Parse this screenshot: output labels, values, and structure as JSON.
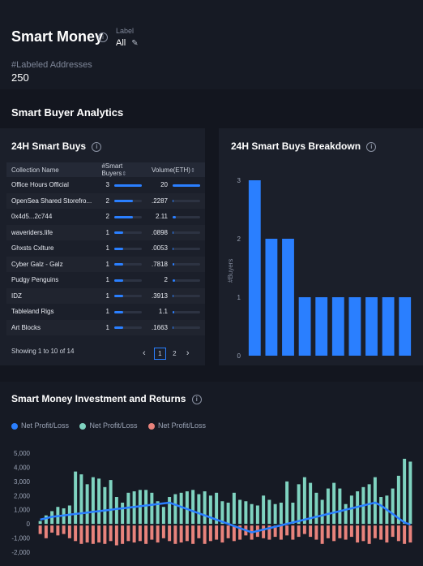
{
  "header": {
    "title": "Smart Money",
    "label_caption": "Label",
    "label_value": "All",
    "count_caption": "#Labeled Addresses",
    "count_value": "250"
  },
  "section_title": "Smart Buyer Analytics",
  "smart_buys": {
    "title": "24H Smart Buys",
    "columns": [
      "Collection Name",
      "#Smart Buyers",
      "Volume(ETH)"
    ],
    "rows": [
      {
        "name": "Office Hours Official",
        "buyers": "3",
        "volume": "20"
      },
      {
        "name": "OpenSea Shared Storefro...",
        "buyers": "2",
        "volume": ".2287"
      },
      {
        "name": "0x4d5...2c744",
        "buyers": "2",
        "volume": "2.11"
      },
      {
        "name": "waveriders.life",
        "buyers": "1",
        "volume": ".0898"
      },
      {
        "name": "Ghxsts Cxlture",
        "buyers": "1",
        "volume": ".0053"
      },
      {
        "name": "Cyber Galz - Galz",
        "buyers": "1",
        "volume": ".7818"
      },
      {
        "name": "Pudgy Penguins",
        "buyers": "1",
        "volume": "2"
      },
      {
        "name": "IDZ",
        "buyers": "1",
        "volume": ".3913"
      },
      {
        "name": "Tableland Rigs",
        "buyers": "1",
        "volume": "1.1"
      },
      {
        "name": "Art Blocks",
        "buyers": "1",
        "volume": ".1663"
      }
    ],
    "buyers_fraction": [
      1,
      0.67,
      0.67,
      0.33,
      0.33,
      0.33,
      0.33,
      0.33,
      0.33,
      0.33
    ],
    "volume_fraction": [
      1,
      0.03,
      0.11,
      0.02,
      0.01,
      0.05,
      0.1,
      0.03,
      0.06,
      0.02
    ],
    "footer": "Showing 1 to 10 of 14",
    "pages": [
      "1",
      "2"
    ],
    "prev": "‹",
    "next": "›"
  },
  "breakdown": {
    "title": "24H Smart Buys Breakdown"
  },
  "investment": {
    "title": "Smart Money Investment and Returns",
    "legend": [
      "Net Profit/Loss",
      "Net Profit/Loss",
      "Net Profit/Loss"
    ]
  },
  "colors": {
    "blue": "#2a7fff",
    "teal": "#7fd3c0",
    "salmon": "#e8837c"
  },
  "chart_data": [
    {
      "type": "bar",
      "title": "24H Smart Buys Breakdown",
      "ylabel": "#Buyers",
      "ylim": [
        0,
        3
      ],
      "yticks": [
        "0",
        "1",
        "2",
        "3"
      ],
      "values": [
        3,
        2,
        2,
        1,
        1,
        1,
        1,
        1,
        1,
        1
      ],
      "grid": false
    },
    {
      "type": "bar",
      "title": "Smart Money Investment and Returns",
      "ylim": [
        -2000,
        5000
      ],
      "yticks": [
        "5,000",
        "4,000",
        "3,000",
        "2,000",
        "1,000",
        "0",
        "-1,000",
        "-2,000"
      ],
      "series": [
        {
          "name": "Net Profit/Loss",
          "kind": "line",
          "color": "#2a7fff",
          "values": [
            300,
            400,
            500,
            550,
            600,
            650,
            700,
            750,
            800,
            850,
            900,
            950,
            1000,
            1050,
            1100,
            1150,
            1200,
            1250,
            1300,
            1350,
            1400,
            1450,
            1500,
            1350,
            1200,
            1050,
            900,
            750,
            600,
            450,
            300,
            150,
            0,
            -150,
            -300,
            -450,
            -600,
            -500,
            -400,
            -300,
            -200,
            -100,
            0,
            100,
            200,
            300,
            400,
            500,
            600,
            700,
            800,
            900,
            1000,
            1100,
            1200,
            1300,
            1400,
            1500,
            1300,
            1000,
            700,
            400,
            100,
            -50
          ]
        },
        {
          "name": "Net Profit/Loss",
          "kind": "bar",
          "color": "#7fd3c0",
          "values": [
            200,
            600,
            900,
            1200,
            1100,
            1300,
            3700,
            3500,
            2800,
            3300,
            3200,
            2600,
            3100,
            1900,
            1500,
            2200,
            2300,
            2400,
            2400,
            2200,
            1600,
            1200,
            1900,
            2100,
            2200,
            2300,
            2400,
            2100,
            2300,
            2000,
            2200,
            1600,
            1500,
            2200,
            1700,
            1600,
            1400,
            1300,
            2000,
            1700,
            1400,
            1500,
            3000,
            1500,
            2800,
            3300,
            2900,
            2200,
            1700,
            2500,
            2900,
            2500,
            1400,
            2000,
            2300,
            2600,
            2800,
            3300,
            1900,
            2000,
            2500,
            3400,
            4600,
            4400
          ]
        },
        {
          "name": "Net Profit/Loss",
          "kind": "bar",
          "color": "#e8837c",
          "values": [
            -600,
            -900,
            -500,
            -700,
            -600,
            -900,
            -1100,
            -1300,
            -1200,
            -1300,
            -1200,
            -1300,
            -1100,
            -1400,
            -1300,
            -1100,
            -1200,
            -1100,
            -1300,
            -1000,
            -1200,
            -900,
            -1100,
            -1300,
            -1200,
            -1100,
            -1300,
            -900,
            -1300,
            -1100,
            -1000,
            -1200,
            -900,
            -1100,
            -1000,
            -700,
            -1000,
            -800,
            -900,
            -1000,
            -800,
            -1000,
            -700,
            -1000,
            -800,
            -600,
            -800,
            -1000,
            -1300,
            -900,
            -1100,
            -900,
            -1000,
            -800,
            -1200,
            -1100,
            -1300,
            -900,
            -1000,
            -1200,
            -800,
            -1100,
            -1300,
            -1200
          ]
        }
      ]
    }
  ]
}
